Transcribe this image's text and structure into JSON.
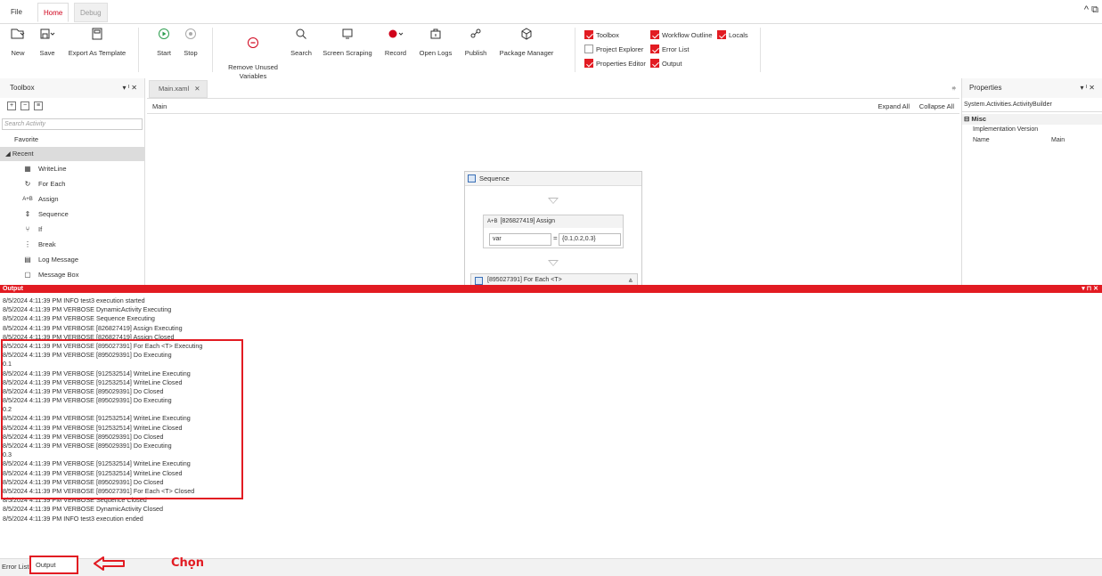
{
  "menu": {
    "tabs": [
      {
        "label": "File"
      },
      {
        "label": "Home"
      },
      {
        "label": "Debug"
      }
    ],
    "window_controls": "^ ⧉"
  },
  "ribbon": {
    "buttons": [
      {
        "label": "New",
        "icon": "new-file-icon"
      },
      {
        "label": "Save",
        "icon": "save-icon"
      },
      {
        "label": "Export As Template",
        "icon": "export-template-icon"
      },
      {
        "label": "Start",
        "icon": "play-icon"
      },
      {
        "label": "Stop",
        "icon": "stop-icon"
      },
      {
        "label": "Remove Unused\nVariables",
        "icon": "remove-icon"
      },
      {
        "label": "Search",
        "icon": "search-icon"
      },
      {
        "label": "Screen Scraping",
        "icon": "screen-scraping-icon"
      },
      {
        "label": "Record",
        "icon": "record-icon"
      },
      {
        "label": "Open Logs",
        "icon": "open-logs-icon"
      },
      {
        "label": "Publish",
        "icon": "publish-icon"
      },
      {
        "label": "Package Manager",
        "icon": "package-manager-icon"
      }
    ],
    "checks": [
      {
        "label": "Toolbox",
        "checked": true
      },
      {
        "label": "Project Explorer",
        "checked": false
      },
      {
        "label": "Properties Editor",
        "checked": true
      },
      {
        "label": "Workflow Outline",
        "checked": true
      },
      {
        "label": "Error List",
        "checked": true
      },
      {
        "label": "Output",
        "checked": true
      },
      {
        "label": "Locals",
        "checked": true
      }
    ]
  },
  "toolbox": {
    "title": "Toolbox",
    "controls": "▾ ᴵ ✕",
    "search_placeholder": "Search Activity",
    "favorite": "Favorite",
    "recent": "◢ Recent",
    "activities": [
      {
        "label": "WriteLine",
        "icon": "writeline-icon"
      },
      {
        "label": "For Each",
        "icon": "foreach-icon"
      },
      {
        "label": "Assign",
        "icon": "assign-icon"
      },
      {
        "label": "Sequence",
        "icon": "sequence-icon"
      },
      {
        "label": "If",
        "icon": "if-icon"
      },
      {
        "label": "Break",
        "icon": "break-icon"
      },
      {
        "label": "Log Message",
        "icon": "log-message-icon"
      },
      {
        "label": "Message Box",
        "icon": "message-box-icon"
      }
    ]
  },
  "designer": {
    "tab": "Main.xaml",
    "tab_close": "✕",
    "filter_icon": "⩷",
    "breadcrumb": "Main",
    "expand_all": "Expand All",
    "collapse_all": "Collapse All",
    "sequence_title": "Sequence",
    "assign_title": "[826827419] Assign",
    "assign_icon_text": "A+B",
    "assign_to": "var",
    "assign_eq": "=",
    "assign_value": "{0.1,0.2,0.3}",
    "foreach_title": "[895027391] For Each <T>",
    "foreach_collapse": "⩓"
  },
  "properties": {
    "title": "Properties",
    "controls": "▾ ᴵ ✕",
    "type": "System.Activities.ActivityBuilder",
    "section": "⊟ Misc",
    "rows": [
      {
        "name": "Implementation Version",
        "value": ""
      },
      {
        "name": "Name",
        "value": "Main"
      }
    ]
  },
  "output": {
    "title": "Output",
    "controls": "▾ ⊓ ✕",
    "lines": [
      "8/5/2024 4:11:39 PM INFO test3 execution started",
      "8/5/2024 4:11:39 PM VERBOSE DynamicActivity Executing",
      "8/5/2024 4:11:39 PM VERBOSE Sequence Executing",
      "8/5/2024 4:11:39 PM VERBOSE [826827419] Assign Executing",
      "8/5/2024 4:11:39 PM VERBOSE [826827419] Assign Closed",
      "8/5/2024 4:11:39 PM VERBOSE [895027391] For Each <T> Executing",
      "8/5/2024 4:11:39 PM VERBOSE [895029391] Do Executing",
      "0.1",
      "8/5/2024 4:11:39 PM VERBOSE [912532514] WriteLine Executing",
      "8/5/2024 4:11:39 PM VERBOSE [912532514] WriteLine Closed",
      "8/5/2024 4:11:39 PM VERBOSE [895029391] Do Closed",
      "8/5/2024 4:11:39 PM VERBOSE [895029391] Do Executing",
      "0.2",
      "8/5/2024 4:11:39 PM VERBOSE [912532514] WriteLine Executing",
      "8/5/2024 4:11:39 PM VERBOSE [912532514] WriteLine Closed",
      "8/5/2024 4:11:39 PM VERBOSE [895029391] Do Closed",
      "8/5/2024 4:11:39 PM VERBOSE [895029391] Do Executing",
      "0.3",
      "8/5/2024 4:11:39 PM VERBOSE [912532514] WriteLine Executing",
      "8/5/2024 4:11:39 PM VERBOSE [912532514] WriteLine Closed",
      "8/5/2024 4:11:39 PM VERBOSE [895029391] Do Closed",
      "8/5/2024 4:11:39 PM VERBOSE [895027391] For Each <T> Closed",
      "8/5/2024 4:11:39 PM VERBOSE Sequence Closed",
      "8/5/2024 4:11:39 PM VERBOSE DynamicActivity Closed",
      "8/5/2024 4:11:39 PM INFO test3 execution ended"
    ]
  },
  "bottom": {
    "error_list": "Error List",
    "output": "Output",
    "annotation": "Chọn"
  },
  "colors": {
    "accent": "#e21b22"
  }
}
